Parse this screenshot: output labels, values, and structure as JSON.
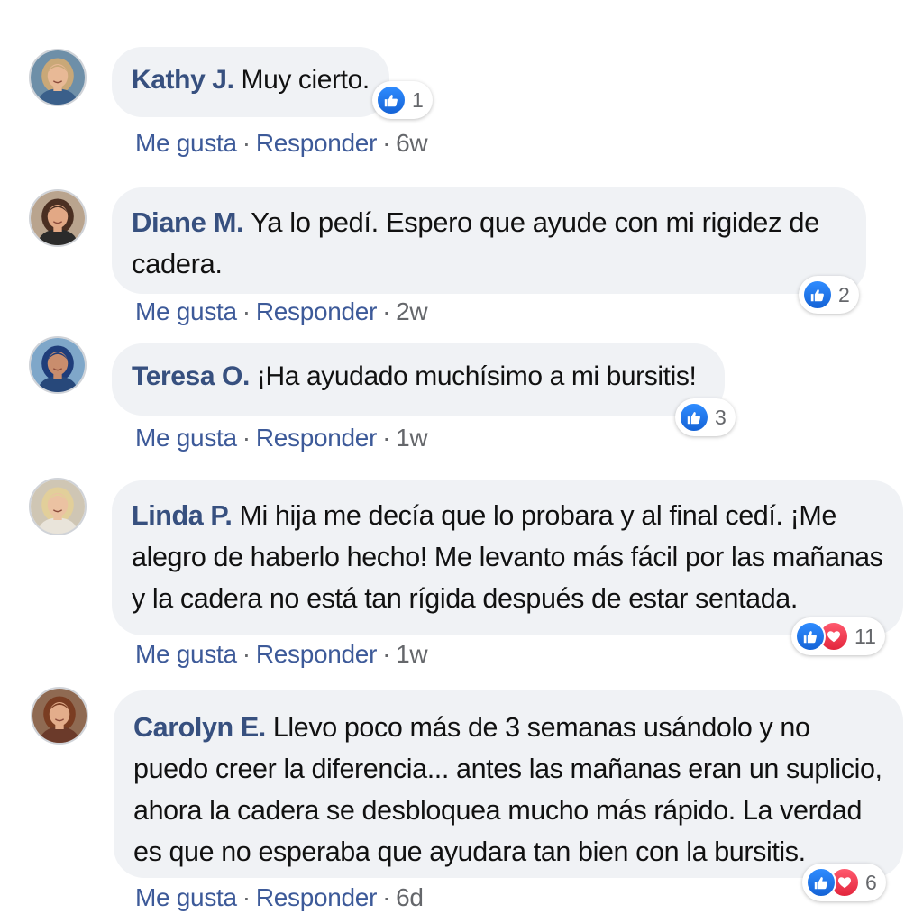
{
  "actions": {
    "like_label": "Me gusta",
    "reply_label": "Responder",
    "separator": "·"
  },
  "comments": [
    {
      "author": "Kathy J.",
      "text": "Muy cierto.",
      "reaction_count": "1",
      "reactions": [
        "like-icon"
      ],
      "time": "6w",
      "avatar": {
        "skin": "#e8b996",
        "hair": "#c9a878",
        "bg": "#6e8fa8",
        "shirt": "#3a5f8a"
      }
    },
    {
      "author": "Diane M.",
      "text": "Ya lo pedí. Espero que ayude con mi rigidez de cadera.",
      "reaction_count": "2",
      "reactions": [
        "like-icon"
      ],
      "time": "2w",
      "avatar": {
        "skin": "#e2a885",
        "hair": "#4a2f22",
        "bg": "#b9a48e",
        "shirt": "#2b2b2b"
      }
    },
    {
      "author": "Teresa O.",
      "text": "¡Ha ayudado muchísimo a mi bursitis!",
      "reaction_count": "3",
      "reactions": [
        "like-icon"
      ],
      "time": "1w",
      "avatar": {
        "skin": "#c98d6d",
        "hair": "#1f3d7a",
        "bg": "#7fa7c9",
        "shirt": "#27487a"
      }
    },
    {
      "author": "Linda P.",
      "text": "Mi hija me decía que lo probara y al final cedí. ¡Me alegro de haberlo hecho! Me levanto más fácil por las mañanas y la cadera no está tan rígida después de estar sentada.",
      "reaction_count": "11",
      "reactions": [
        "like-icon",
        "heart-icon"
      ],
      "time": "1w",
      "avatar": {
        "skin": "#ebc2a2",
        "hair": "#e2cf9a",
        "bg": "#cfc6b4",
        "shirt": "#e9e4da"
      }
    },
    {
      "author": "Carolyn E.",
      "text": "Llevo poco más de 3 semanas usándolo y no puedo creer la diferencia... antes las mañanas eran un suplicio, ahora la cadera se desbloquea mucho más rápido. La verdad es que no esperaba que ayudara tan bien con la bursitis.",
      "reaction_count": "6",
      "reactions": [
        "like-icon",
        "heart-icon"
      ],
      "time": "6d",
      "avatar": {
        "skin": "#e3ad8b",
        "hair": "#7a3d22",
        "bg": "#8f6a52",
        "shirt": "#6b3a2a"
      }
    }
  ]
}
